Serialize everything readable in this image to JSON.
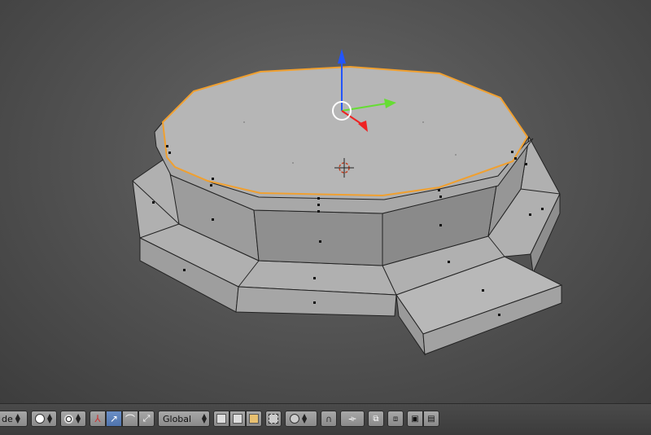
{
  "viewport": {
    "name": "3d-viewport"
  },
  "header": {
    "mode_label": "de",
    "orientation_label": "Global"
  },
  "colors": {
    "selection": "#f0a030",
    "axis_z": "#2255ff",
    "axis_y": "#66dd33",
    "axis_x": "#ee2222",
    "mesh_top": "#b4b4b4",
    "mesh_side": "#9a9a9a"
  }
}
